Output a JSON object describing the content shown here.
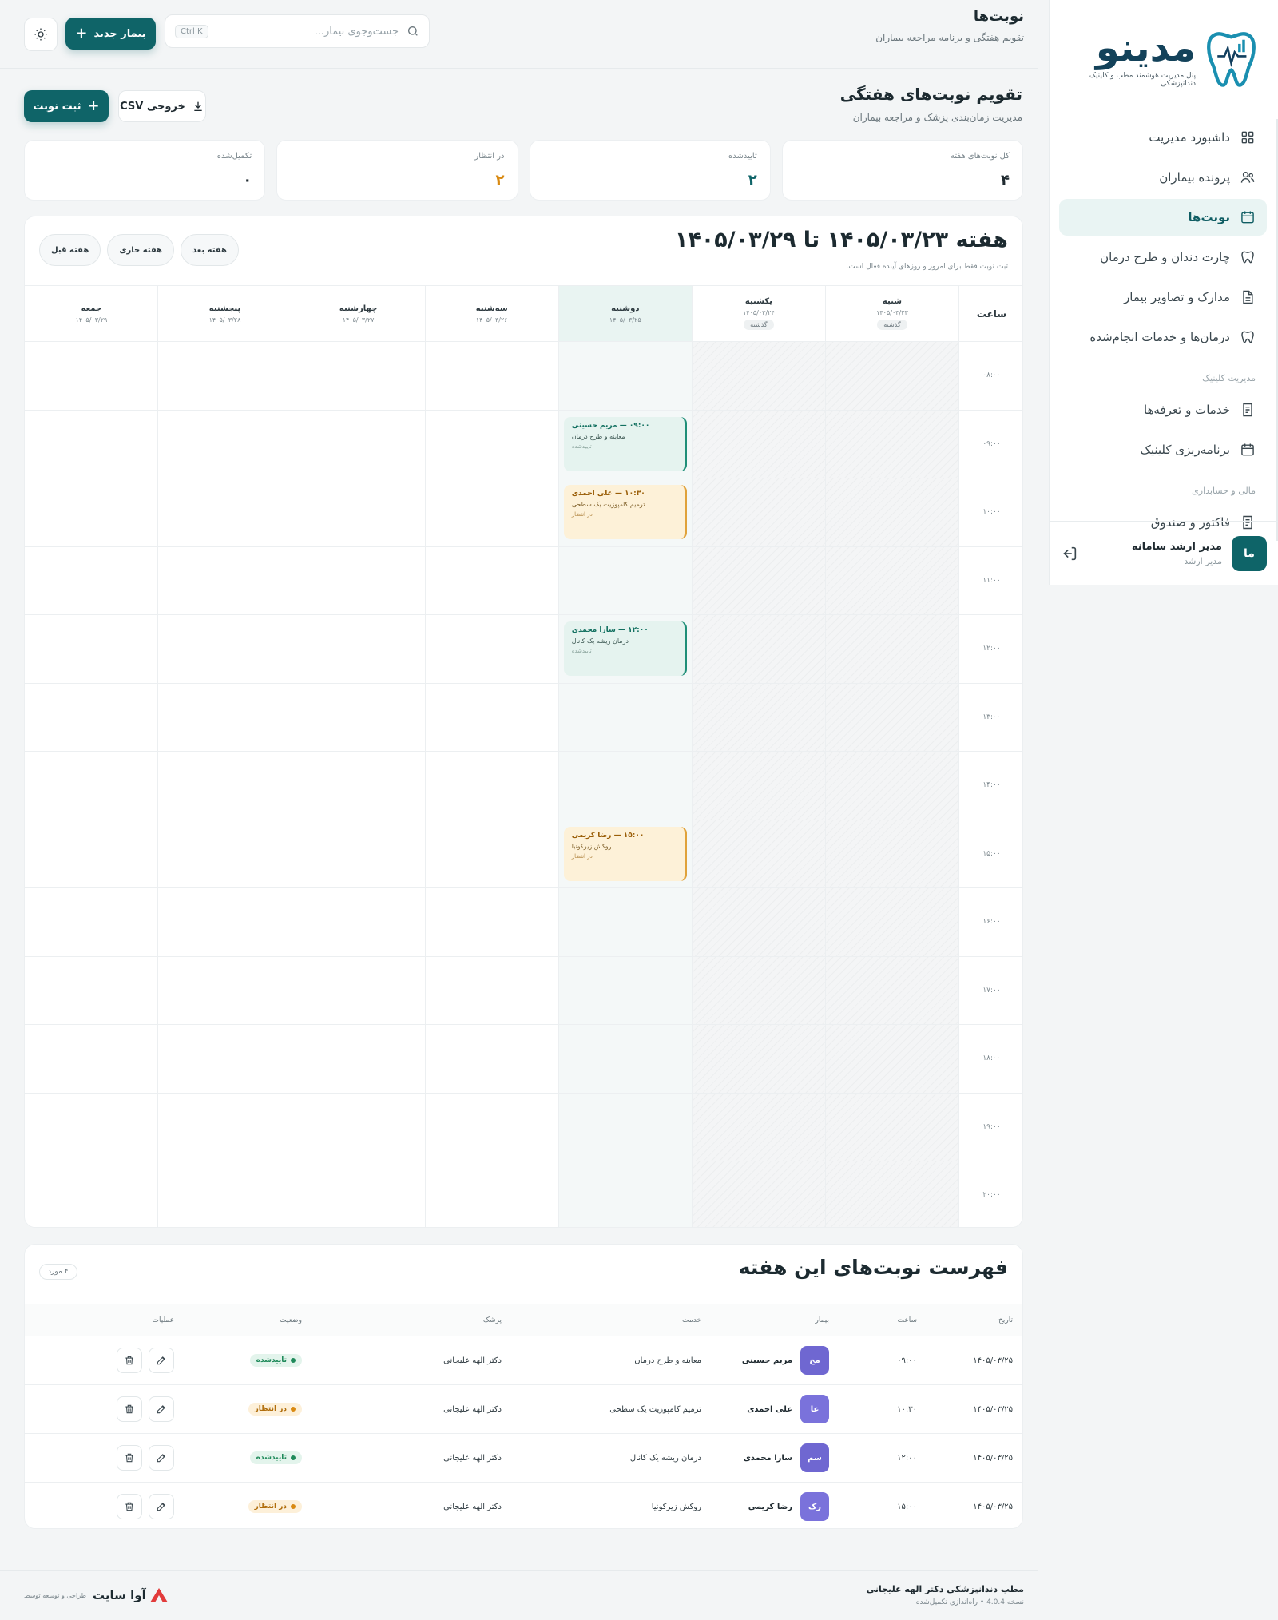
{
  "brand": {
    "name": "مدینو",
    "tagline": "پنل مدیریت هوشمند مطب و کلینیک دندانپزشکی"
  },
  "sidebar": {
    "items": [
      {
        "label": "داشبورد مدیریت",
        "icon": "dashboard-icon"
      },
      {
        "label": "پرونده بیماران",
        "icon": "users-icon"
      },
      {
        "label": "نوبت‌ها",
        "icon": "calendar-icon",
        "active": true
      },
      {
        "label": "چارت دندان و طرح درمان",
        "icon": "tooth-icon"
      },
      {
        "label": "مدارک و تصاویر بیمار",
        "icon": "file-icon"
      },
      {
        "label": "درمان‌ها و خدمات انجام‌شده",
        "icon": "tooth-icon"
      }
    ],
    "section_clinic": "مدیریت کلینیک",
    "clinic_items": [
      {
        "label": "خدمات و تعرفه‌ها",
        "icon": "receipt-icon"
      },
      {
        "label": "برنامه‌ریزی کلینیک",
        "icon": "calendar-icon"
      }
    ],
    "section_finance": "مالی و حسابداری",
    "finance_items": [
      {
        "label": "فاکتور و صندوق",
        "icon": "receipt-icon"
      }
    ],
    "user": {
      "initials": "ما",
      "name": "مدیر ارشد سامانه",
      "role": "مدیر ارشد"
    }
  },
  "header": {
    "title": "نوبت‌ها",
    "subtitle": "تقویم هفتگی و برنامه مراجعه بیماران",
    "search_placeholder": "جست‌وجوی بیمار...",
    "search_shortcut": "Ctrl K",
    "new_patient_label": "بیمار جدید"
  },
  "calendar_header": {
    "title": "تقویم نوبت‌های هفتگی",
    "subtitle": "مدیریت زمان‌بندی پزشک و مراجعه بیماران",
    "csv_label": "خروجی CSV",
    "add_label": "ثبت نوبت"
  },
  "stats": [
    {
      "label": "کل نوبت‌های هفته",
      "value": "۴",
      "color": "#1f2a30"
    },
    {
      "label": "تاییدشده",
      "value": "۲",
      "color": "#0f6468"
    },
    {
      "label": "در انتظار",
      "value": "۲",
      "color": "#d98a12"
    },
    {
      "label": "تکمیل‌شده",
      "value": "۰",
      "color": "#1f2a30"
    }
  ],
  "week": {
    "title": "هفته ۱۴۰۵/۰۳/۲۳ تا ۱۴۰۵/۰۳/۲۹",
    "note": "ثبت نوبت فقط برای امروز و روزهای آینده فعال است.",
    "prev_label": "هفته قبل",
    "current_label": "هفته جاری",
    "next_label": "هفته بعد",
    "time_header": "ساعت",
    "days": [
      {
        "name": "شنبه",
        "date": "۱۴۰۵/۰۳/۲۳",
        "tag": "گذشته",
        "past": true
      },
      {
        "name": "یکشنبه",
        "date": "۱۴۰۵/۰۳/۲۴",
        "tag": "گذشته",
        "past": true
      },
      {
        "name": "دوشنبه",
        "date": "۱۴۰۵/۰۳/۲۵",
        "today": true
      },
      {
        "name": "سه‌شنبه",
        "date": "۱۴۰۵/۰۳/۲۶"
      },
      {
        "name": "چهارشنبه",
        "date": "۱۴۰۵/۰۳/۲۷"
      },
      {
        "name": "پنجشنبه",
        "date": "۱۴۰۵/۰۳/۲۸"
      },
      {
        "name": "جمعه",
        "date": "۱۴۰۵/۰۳/۲۹"
      }
    ],
    "hours": [
      "۰۸:۰۰",
      "۰۹:۰۰",
      "۱۰:۰۰",
      "۱۱:۰۰",
      "۱۲:۰۰",
      "۱۳:۰۰",
      "۱۴:۰۰",
      "۱۵:۰۰",
      "۱۶:۰۰",
      "۱۷:۰۰",
      "۱۸:۰۰",
      "۱۹:۰۰",
      "۲۰:۰۰"
    ],
    "appointments": [
      {
        "day": 2,
        "hour_index": 1,
        "title": "۰۹:۰۰ — مریم حسینی",
        "service": "معاینه و طرح درمان",
        "status": "تاییدشده",
        "variant": "green"
      },
      {
        "day": 2,
        "hour_index": 2,
        "title": "۱۰:۳۰ — علی احمدی",
        "service": "ترمیم کامپوزیت یک سطحی",
        "status": "در انتظار",
        "variant": "yellow"
      },
      {
        "day": 2,
        "hour_index": 4,
        "title": "۱۲:۰۰ — سارا محمدی",
        "service": "درمان ریشه یک کانال",
        "status": "تاییدشده",
        "variant": "green"
      },
      {
        "day": 2,
        "hour_index": 7,
        "title": "۱۵:۰۰ — رضا کریمی",
        "service": "روکش زیرکونیا",
        "status": "در انتظار",
        "variant": "yellow"
      }
    ]
  },
  "list": {
    "title": "فهرست نوبت‌های این هفته",
    "count": "۴ مورد",
    "columns": {
      "date": "تاریخ",
      "time": "ساعت",
      "patient": "بیمار",
      "service": "خدمت",
      "doctor": "پزشک",
      "status": "وضعیت",
      "actions": "عملیات"
    },
    "rows": [
      {
        "date": "۱۴۰۵/۰۳/۲۵",
        "time": "۰۹:۰۰",
        "initials": "مح",
        "patient": "مریم حسینی",
        "service": "معاینه و طرح درمان",
        "doctor": "دکتر الهه علیجانی",
        "status": "تاییدشده",
        "status_type": "ok"
      },
      {
        "date": "۱۴۰۵/۰۳/۲۵",
        "time": "۱۰:۳۰",
        "initials": "عا",
        "patient": "علی احمدی",
        "service": "ترمیم کامپوزیت یک سطحی",
        "doctor": "دکتر الهه علیجانی",
        "status": "در انتظار",
        "status_type": "wait"
      },
      {
        "date": "۱۴۰۵/۰۳/۲۵",
        "time": "۱۲:۰۰",
        "initials": "سم",
        "patient": "سارا محمدی",
        "service": "درمان ریشه یک کانال",
        "doctor": "دکتر الهه علیجانی",
        "status": "تاییدشده",
        "status_type": "ok"
      },
      {
        "date": "۱۴۰۵/۰۳/۲۵",
        "time": "۱۵:۰۰",
        "initials": "رک",
        "patient": "رضا کریمی",
        "service": "روکش زیرکونیا",
        "doctor": "دکتر الهه علیجانی",
        "status": "در انتظار",
        "status_type": "wait"
      }
    ]
  },
  "footer": {
    "clinic_name": "مطب دندانپزشکی دکتر الهه علیجانی",
    "version": "نسخه 4.0.4 • راه‌اندازی تکمیل‌شده",
    "credit_label": "طراحی و توسعه توسط",
    "credit_brand": "آوا سایت"
  }
}
